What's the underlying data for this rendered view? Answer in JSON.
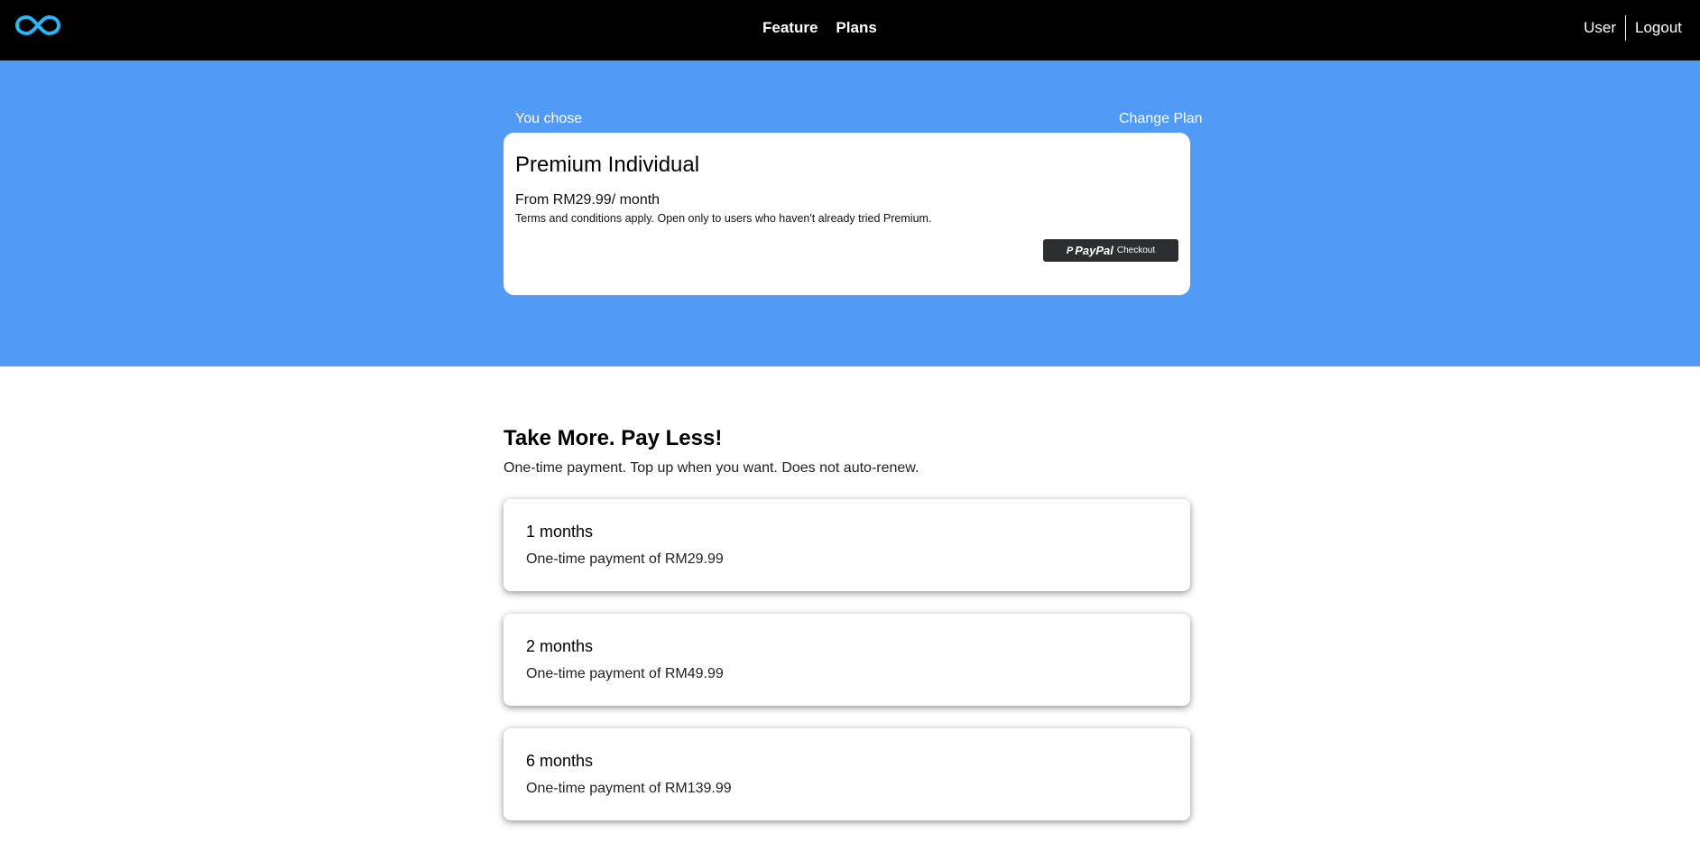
{
  "header": {
    "logo_icon": "infinity-logo-icon",
    "nav": [
      {
        "label": "Feature"
      },
      {
        "label": "Plans"
      }
    ],
    "user_label": "User",
    "logout_label": "Logout"
  },
  "selected_plan": {
    "you_chose_label": "You chose",
    "change_plan_label": "Change Plan",
    "name": "Premium Individual",
    "price": "From RM29.99/ month",
    "terms": "Terms and conditions apply. Open only to users who haven't already tried Premium.",
    "paypal_button": {
      "icon": "paypal-p-icon",
      "brand": "PayPal",
      "label": "Checkout"
    }
  },
  "offers": {
    "title": "Take More. Pay Less!",
    "subtitle": "One-time payment. Top up when you want. Does not auto-renew.",
    "items": [
      {
        "duration": "1 months",
        "payment": "One-time payment of RM29.99"
      },
      {
        "duration": "2 months",
        "payment": "One-time payment of RM49.99"
      },
      {
        "duration": "6 months",
        "payment": "One-time payment of RM139.99"
      }
    ]
  },
  "colors": {
    "topbar": "#000000",
    "hero": "#519bf6",
    "logo": "#29b6f6",
    "paypal_button": "#2c2e2f"
  }
}
